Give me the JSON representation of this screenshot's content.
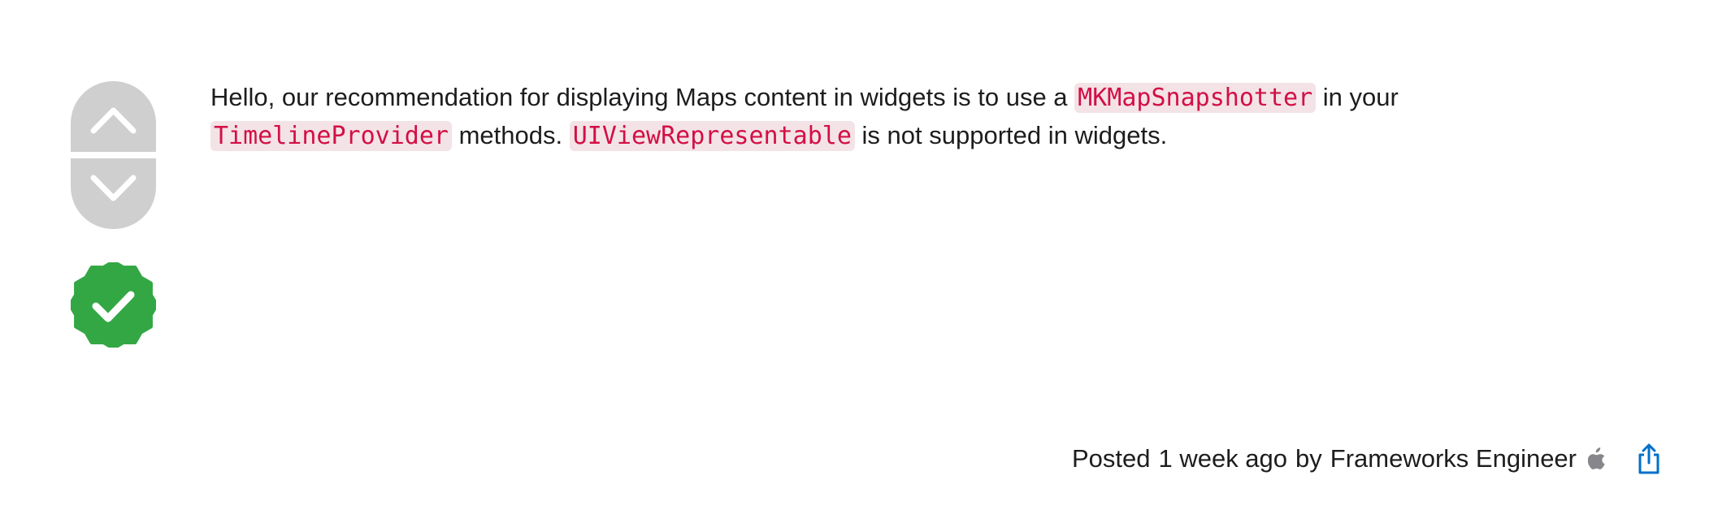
{
  "answer": {
    "text_1": "Hello, our recommendation for displaying Maps content in widgets is to use a ",
    "code_1": "MKMapSnapshotter",
    "text_2": " in your ",
    "code_2": "TimelineProvider",
    "text_3": " methods. ",
    "code_3": "UIViewRepresentable",
    "text_4": " is not supported in widgets."
  },
  "meta": {
    "posted_label": "Posted",
    "time": "1 week ago",
    "by_label": "by",
    "author": "Frameworks Engineer"
  },
  "colors": {
    "vote_bg": "#cfcfcf",
    "accepted_green": "#34a745",
    "code_text": "#d30f45",
    "code_bg": "#f3e3e6",
    "link_blue": "#0070c9"
  },
  "icons": {
    "upvote": "chevron-up-icon",
    "downvote": "chevron-down-icon",
    "accepted": "checkmark-badge-icon",
    "author_badge": "apple-logo-icon",
    "share": "share-icon"
  }
}
